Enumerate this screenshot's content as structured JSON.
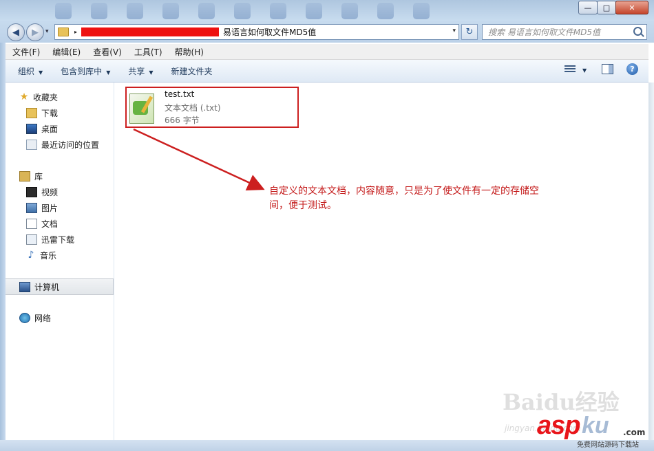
{
  "window": {
    "controls": {
      "minimize": "—",
      "maximize": "□",
      "close": "✕"
    }
  },
  "addressbar": {
    "current_folder": "易语言如何取文件MD5值",
    "crumb_separator": "▸",
    "dropdown": "▾",
    "back_glyph": "◀",
    "forward_glyph": "▶",
    "refresh_glyph": "↻"
  },
  "search": {
    "placeholder": "搜索 易语言如何取文件MD5值"
  },
  "menu": {
    "items": [
      "文件(F)",
      "编辑(E)",
      "查看(V)",
      "工具(T)",
      "帮助(H)"
    ]
  },
  "commandbar": {
    "organize": "组织",
    "include_in_library": "包含到库中",
    "share": "共享",
    "new_folder": "新建文件夹",
    "dropdown": "▼",
    "help_glyph": "?"
  },
  "sidebar": {
    "favorites": {
      "label": "收藏夹",
      "items": [
        "下载",
        "桌面",
        "最近访问的位置"
      ]
    },
    "libraries": {
      "label": "库",
      "items": [
        "视频",
        "图片",
        "文档",
        "迅雷下载",
        "音乐"
      ]
    },
    "computer": {
      "label": "计算机"
    },
    "network": {
      "label": "网络"
    },
    "icons": {
      "star": "★",
      "music": "♪"
    }
  },
  "content": {
    "file": {
      "name": "test.txt",
      "type": "文本文档 (.txt)",
      "size": "666 字节"
    },
    "annotation": "自定义的文本文档，内容随意，只是为了使文件有一定的存储空间，便于测试。"
  },
  "watermarks": {
    "baidu": "Baidu经验",
    "jingyan": "jingyan.baidu.com",
    "asp": "asp",
    "ku": "ku",
    "com": ".com",
    "sub": "免费网站源码下载站"
  },
  "colors": {
    "annotation": "#c41a1a",
    "highlight_box": "#cc1f1f",
    "redaction": "#ee1111"
  }
}
